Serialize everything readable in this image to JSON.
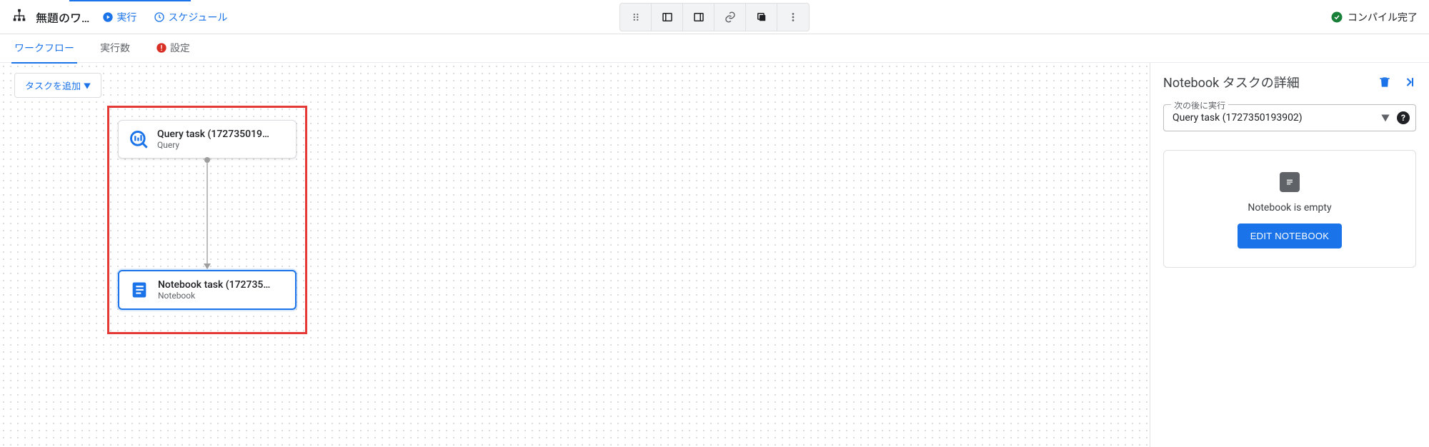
{
  "header": {
    "title": "無題のワ…",
    "run_label": "実行",
    "schedule_label": "スケジュール",
    "status_text": "コンパイル完了"
  },
  "tabs": {
    "workflow": "ワークフロー",
    "runs": "実行数",
    "settings": "設定"
  },
  "toolbar": {
    "add_task_label": "タスクを追加"
  },
  "nodes": {
    "query": {
      "title": "Query task (172735019…",
      "subtitle": "Query"
    },
    "notebook": {
      "title": "Notebook task (172735…",
      "subtitle": "Notebook"
    }
  },
  "panel": {
    "title": "Notebook タスクの詳細",
    "run_after_label": "次の後に実行",
    "run_after_value": "Query task (1727350193902)",
    "empty_text": "Notebook is empty",
    "edit_button": "EDIT NOTEBOOK"
  }
}
